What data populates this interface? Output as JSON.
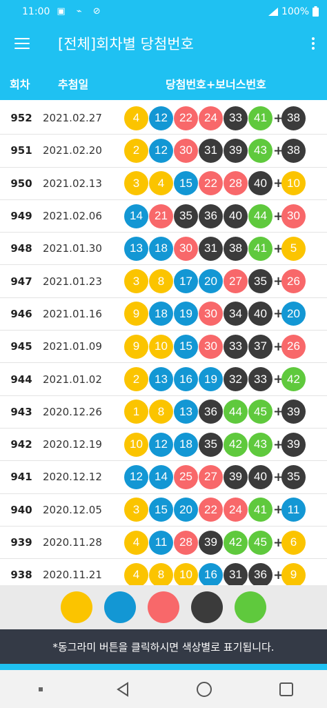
{
  "status": {
    "time": "11:00",
    "battery": "100%"
  },
  "header": {
    "title": "[전체]회차별 당첨번호"
  },
  "table": {
    "col_round": "회차",
    "col_date": "추첨일",
    "col_numbers": "당첨번호+보너스번호"
  },
  "colors": {
    "yellow": "#fbc400",
    "blue": "#1397d4",
    "red": "#f8686a",
    "gray": "#3b3b3b",
    "green": "#5fc93d"
  },
  "rows": [
    {
      "no": "952",
      "date": "2021.02.27",
      "nums": [
        "4",
        "12",
        "22",
        "24",
        "33",
        "41"
      ],
      "bonus": "38"
    },
    {
      "no": "951",
      "date": "2021.02.20",
      "nums": [
        "2",
        "12",
        "30",
        "31",
        "39",
        "43"
      ],
      "bonus": "38"
    },
    {
      "no": "950",
      "date": "2021.02.13",
      "nums": [
        "3",
        "4",
        "15",
        "22",
        "28",
        "40"
      ],
      "bonus": "10"
    },
    {
      "no": "949",
      "date": "2021.02.06",
      "nums": [
        "14",
        "21",
        "35",
        "36",
        "40",
        "44"
      ],
      "bonus": "30"
    },
    {
      "no": "948",
      "date": "2021.01.30",
      "nums": [
        "13",
        "18",
        "30",
        "31",
        "38",
        "41"
      ],
      "bonus": "5"
    },
    {
      "no": "947",
      "date": "2021.01.23",
      "nums": [
        "3",
        "8",
        "17",
        "20",
        "27",
        "35"
      ],
      "bonus": "26"
    },
    {
      "no": "946",
      "date": "2021.01.16",
      "nums": [
        "9",
        "18",
        "19",
        "30",
        "34",
        "40"
      ],
      "bonus": "20"
    },
    {
      "no": "945",
      "date": "2021.01.09",
      "nums": [
        "9",
        "10",
        "15",
        "30",
        "33",
        "37"
      ],
      "bonus": "26"
    },
    {
      "no": "944",
      "date": "2021.01.02",
      "nums": [
        "2",
        "13",
        "16",
        "19",
        "32",
        "33"
      ],
      "bonus": "42"
    },
    {
      "no": "943",
      "date": "2020.12.26",
      "nums": [
        "1",
        "8",
        "13",
        "36",
        "44",
        "45"
      ],
      "bonus": "39"
    },
    {
      "no": "942",
      "date": "2020.12.19",
      "nums": [
        "10",
        "12",
        "18",
        "35",
        "42",
        "43"
      ],
      "bonus": "39"
    },
    {
      "no": "941",
      "date": "2020.12.12",
      "nums": [
        "12",
        "14",
        "25",
        "27",
        "39",
        "40"
      ],
      "bonus": "35"
    },
    {
      "no": "940",
      "date": "2020.12.05",
      "nums": [
        "3",
        "15",
        "20",
        "22",
        "24",
        "41"
      ],
      "bonus": "11"
    },
    {
      "no": "939",
      "date": "2020.11.28",
      "nums": [
        "4",
        "11",
        "28",
        "39",
        "42",
        "45"
      ],
      "bonus": "6"
    },
    {
      "no": "938",
      "date": "2020.11.21",
      "nums": [
        "4",
        "8",
        "10",
        "16",
        "31",
        "36"
      ],
      "bonus": "9"
    }
  ],
  "palette": [
    "yellow",
    "blue",
    "red",
    "gray",
    "green"
  ],
  "footer": {
    "notice": "*동그라미 버튼을 클릭하시면 색상별로 표기됩니다."
  },
  "icons": [
    "menu-icon",
    "more-vert-icon",
    "back-icon",
    "home-icon",
    "recents-icon"
  ]
}
